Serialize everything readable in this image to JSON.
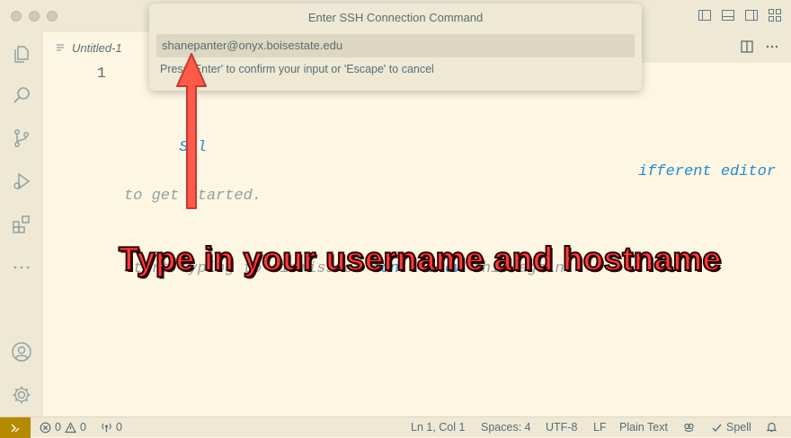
{
  "editor_tab": {
    "label": "Untitled-1"
  },
  "editor": {
    "line_number": "1",
    "hint_line1_start": "Sel",
    "hint_line1_end": "ifferent editor",
    "hint_line2": "to get started.",
    "hint_line3_a": "Start typing to dismiss or ",
    "hint_line3_link": "don't show",
    "hint_line3_b": " this again."
  },
  "quick_input": {
    "title": "Enter SSH Connection Command",
    "value": "shanepanter@onyx.boisestate.edu",
    "message": "Press 'Enter' to confirm your input or 'Escape' to cancel"
  },
  "annotation": {
    "text": "Type in your username and hostname"
  },
  "status_bar": {
    "errors": "0",
    "warnings": "0",
    "ports": "0",
    "cursor": "Ln 1, Col 1",
    "spaces": "Spaces: 4",
    "encoding": "UTF-8",
    "eol": "LF",
    "language": "Plain Text",
    "spell": "Spell"
  },
  "colors": {
    "background": "#fdf6e3",
    "chrome": "#eee8d5",
    "remote_indicator": "#b58900",
    "link": "#268bd2",
    "annotation": "#ff3b3b"
  },
  "icons": [
    "files-icon",
    "search-icon",
    "source-control-icon",
    "run-debug-icon",
    "extensions-icon",
    "more-icon",
    "account-icon",
    "settings-gear-icon",
    "remote-icon",
    "error-icon",
    "warning-icon",
    "ports-icon",
    "copilot-icon",
    "check-icon",
    "bell-icon",
    "split-editor-icon",
    "ellipsis-icon",
    "toggle-panel-icon"
  ]
}
